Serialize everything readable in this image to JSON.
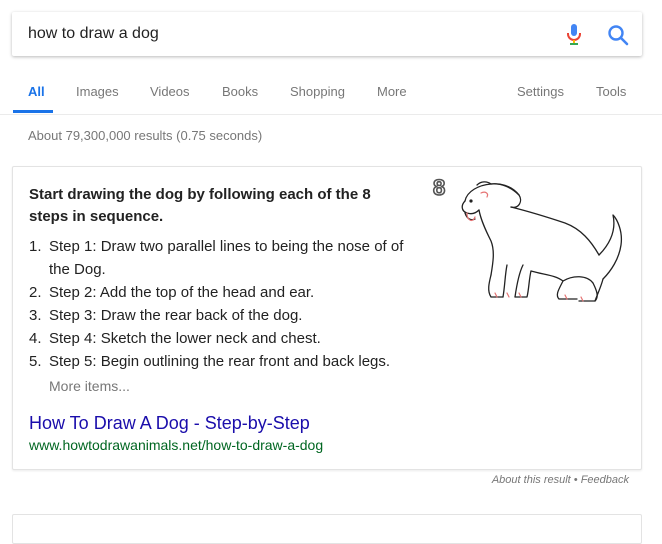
{
  "search": {
    "query": "how to draw a dog"
  },
  "tabs": [
    {
      "label": "All",
      "active": true
    },
    {
      "label": "Images"
    },
    {
      "label": "Videos"
    },
    {
      "label": "Books"
    },
    {
      "label": "Shopping"
    },
    {
      "label": "More"
    },
    {
      "label": "Settings"
    },
    {
      "label": "Tools"
    }
  ],
  "stats": "About 79,300,000 results (0.75 seconds)",
  "snippet": {
    "heading": "Start drawing the dog by following each of the 8 steps in sequence.",
    "steps": [
      {
        "num": "1.",
        "text": "Step 1: Draw two parallel lines to being the nose of of the Dog."
      },
      {
        "num": "2.",
        "text": "Step 2: Add the top of the head and ear."
      },
      {
        "num": "3.",
        "text": "Step 3: Draw the rear back of the dog."
      },
      {
        "num": "4.",
        "text": "Step 4: Sketch the lower neck and chest."
      },
      {
        "num": "5.",
        "text": "Step 5: Begin outlining the rear front and back legs."
      }
    ],
    "more_items": "More items...",
    "link_title": "How To Draw A Dog - Step-by-Step",
    "link_url": "www.howtodrawanimals.net/how-to-draw-a-dog",
    "image_step_number": "8"
  },
  "footer": {
    "about": "About this result",
    "feedback": "Feedback"
  },
  "colors": {
    "link": "#1a0dab",
    "url": "#006621",
    "accent": "#1a73e8"
  },
  "icons": [
    "microphone-icon",
    "search-icon"
  ]
}
